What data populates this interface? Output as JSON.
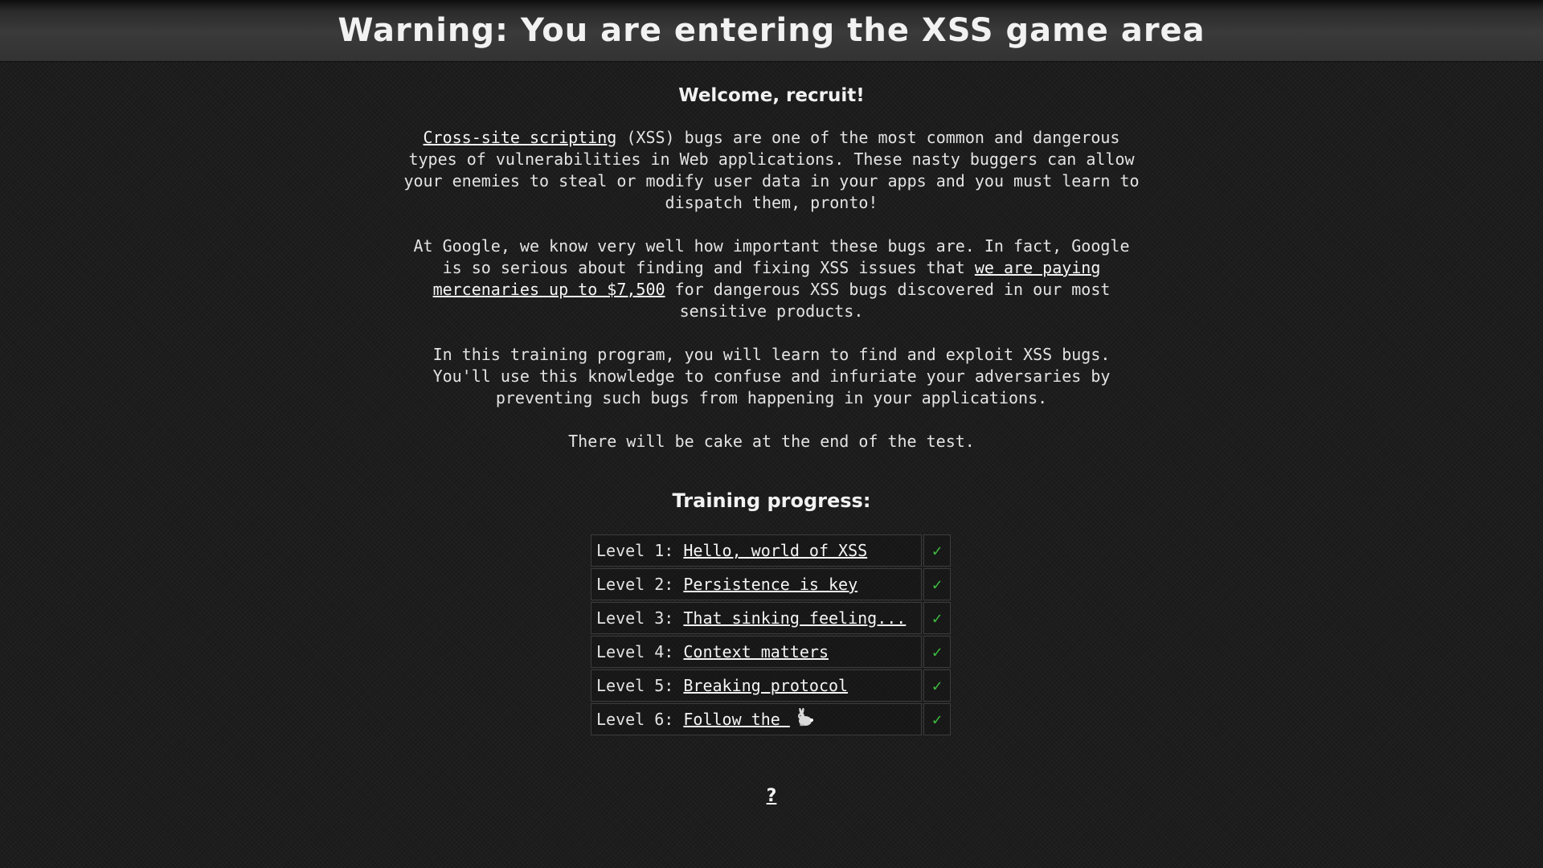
{
  "header": {
    "title": "Warning: You are entering the XSS game area"
  },
  "intro": {
    "heading": "Welcome, recruit!",
    "p1_link": "Cross-site scripting",
    "p1_text": " (XSS) bugs are one of the most common and dangerous types of vulnerabilities in Web applications. These nasty buggers can allow your enemies to steal or modify user data in your apps and you must learn to dispatch them, pronto!",
    "p2_before": "At Google, we know very well how important these bugs are. In fact, Google is so serious about finding and fixing XSS issues that ",
    "p2_link": "we are paying mercenaries up to $7,500",
    "p2_after": " for dangerous XSS bugs discovered in our most sensitive products.",
    "p3": "In this training program, you will learn to find and exploit XSS bugs. You'll use this knowledge to confuse and infuriate your adversaries by preventing such bugs from happening in your applications.",
    "p4": "There will be cake at the end of the test."
  },
  "progress": {
    "title": "Training progress:",
    "levels": [
      {
        "prefix": "Level 1: ",
        "name": "Hello, world of XSS",
        "status": "✓",
        "completed": true
      },
      {
        "prefix": "Level 2: ",
        "name": "Persistence is key",
        "status": "✓",
        "completed": true
      },
      {
        "prefix": "Level 3: ",
        "name": "That sinking feeling...",
        "status": "✓",
        "completed": true
      },
      {
        "prefix": "Level 4: ",
        "name": "Context matters",
        "status": "✓",
        "completed": true
      },
      {
        "prefix": "Level 5: ",
        "name": "Breaking protocol",
        "status": "✓",
        "completed": true
      },
      {
        "prefix": "Level 6: ",
        "name": "Follow the ",
        "icon": "rabbit-icon",
        "status": "✓",
        "completed": true
      }
    ]
  },
  "footer": {
    "help_link": "?"
  },
  "colors": {
    "background": "#1d1d1d",
    "text": "#e3e3e3",
    "check": "#3fbf3f"
  }
}
